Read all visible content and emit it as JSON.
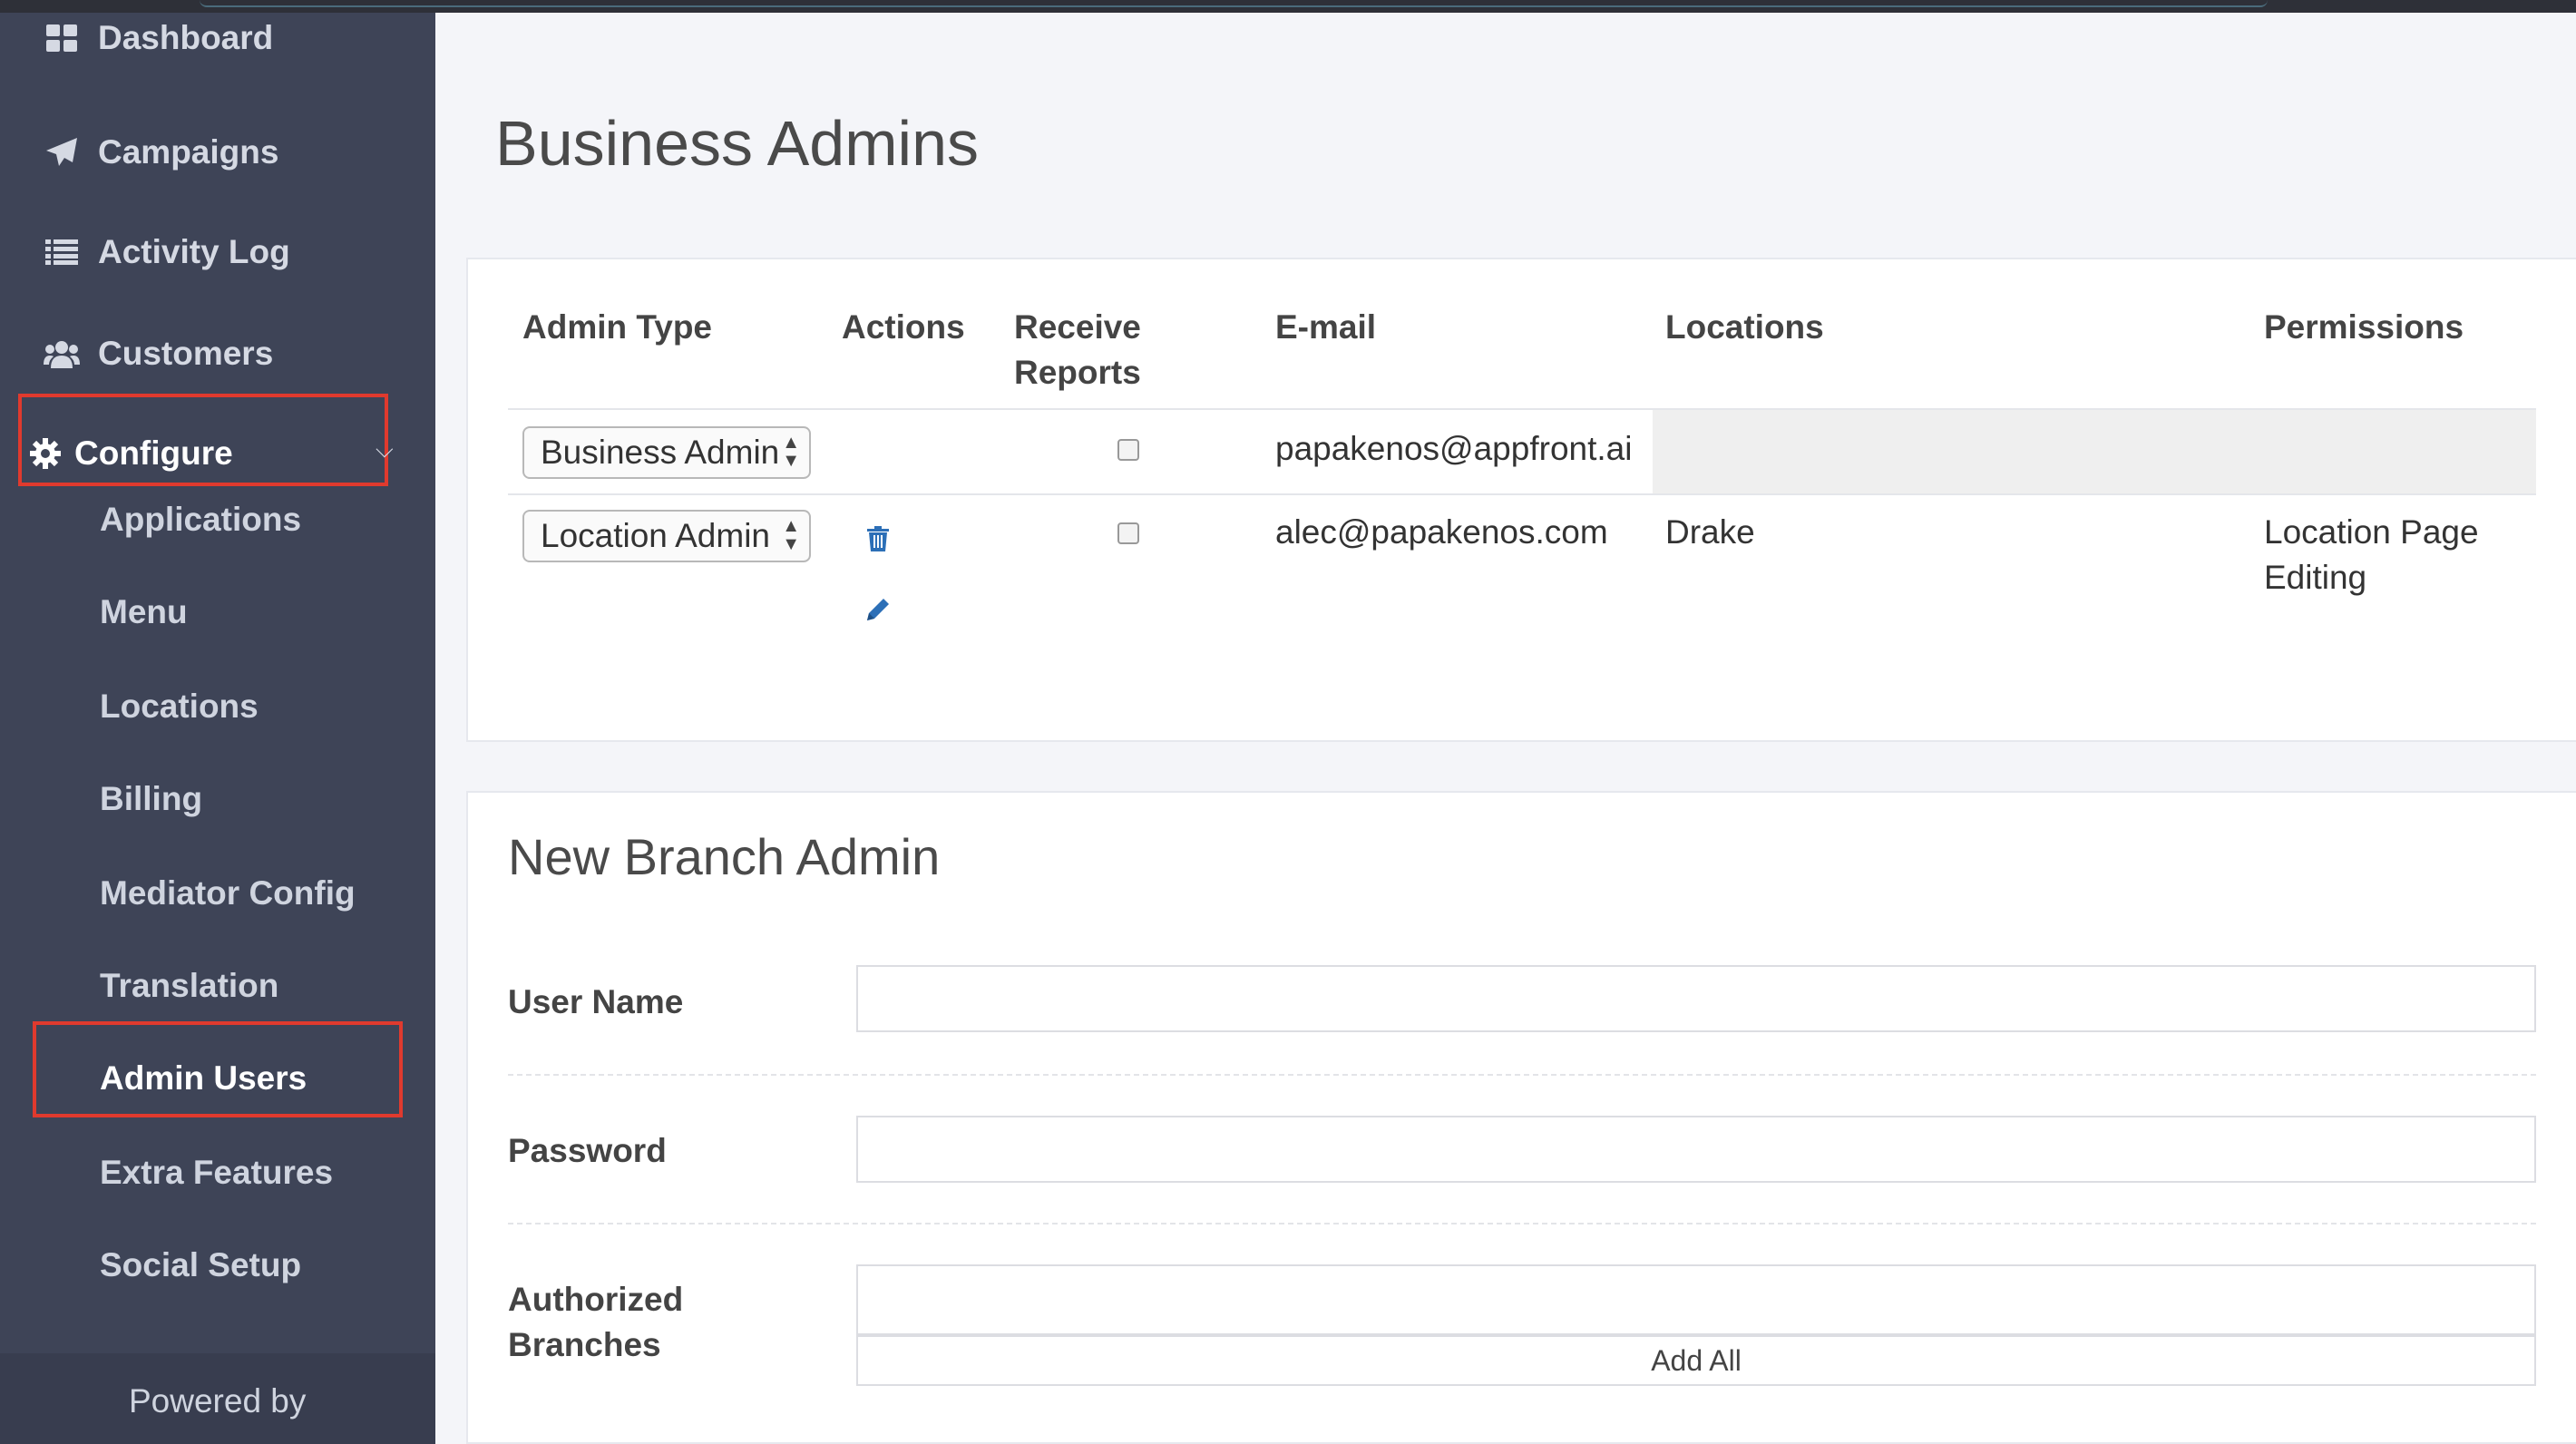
{
  "sidebar": {
    "items": [
      {
        "label": "Dashboard",
        "icon": "dashboard-icon"
      },
      {
        "label": "Campaigns",
        "icon": "paper-plane-icon"
      },
      {
        "label": "Activity Log",
        "icon": "list-icon"
      },
      {
        "label": "Customers",
        "icon": "users-icon"
      },
      {
        "label": "Configure",
        "icon": "gear-icon"
      }
    ],
    "configure_sub": [
      "Applications",
      "Menu",
      "Locations",
      "Billing",
      "Mediator Config",
      "Translation",
      "Admin Users",
      "Extra Features",
      "Social Setup"
    ],
    "footer": "Powered by"
  },
  "page": {
    "title": "Business Admins"
  },
  "admins_table": {
    "headers": {
      "admin_type": "Admin Type",
      "actions": "Actions",
      "receive_reports_1": "Receive",
      "receive_reports_2": "Reports",
      "email": "E-mail",
      "locations": "Locations",
      "permissions": "Permissions"
    },
    "rows": [
      {
        "admin_type": "Business Admin",
        "email": "papakenos@appfront.ai",
        "locations": "",
        "permissions_1": "",
        "permissions_2": ""
      },
      {
        "admin_type": "Location Admin",
        "email": "alec@papakenos.com",
        "locations": "Drake",
        "permissions_1": "Location Page",
        "permissions_2": "Editing"
      }
    ]
  },
  "new_admin": {
    "title": "New Branch Admin",
    "username_label": "User Name",
    "password_label": "Password",
    "branches_label_1": "Authorized",
    "branches_label_2": "Branches",
    "add_all_label": "Add All",
    "username_value": "",
    "password_value": "",
    "branches_value": ""
  },
  "colors": {
    "sidebar_bg": "#3e4457",
    "highlight_box": "#e03a2e",
    "icon_blue": "#2c6fb7"
  }
}
